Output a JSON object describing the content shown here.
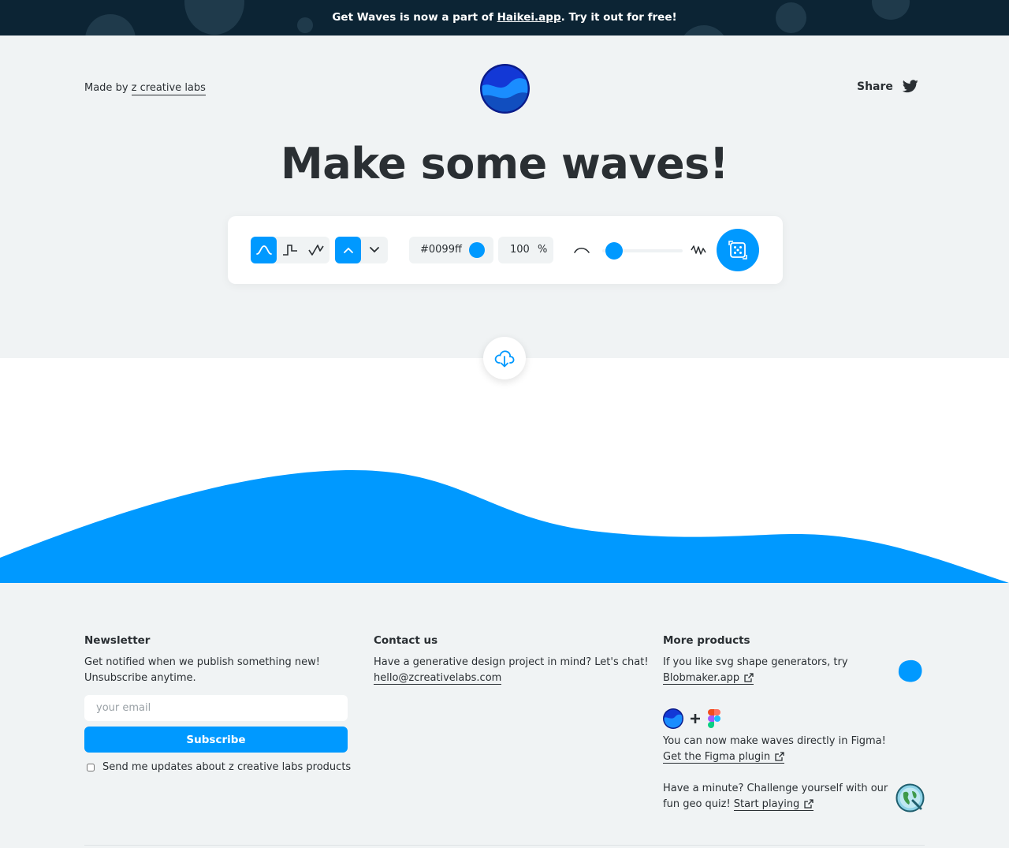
{
  "banner": {
    "text_before": "Get Waves is now a part of ",
    "link": "Haikei.app",
    "text_after": ". Try it out for free!"
  },
  "header": {
    "made_by_prefix": "Made by ",
    "made_by_link": "z creative labs",
    "share_label": "Share"
  },
  "hero": {
    "title": "Make some waves!"
  },
  "toolbar": {
    "wave_types": [
      "smooth-wave-icon",
      "step-wave-icon",
      "peak-wave-icon"
    ],
    "active_wave_type": "smooth-wave-icon",
    "directions": [
      "chevron-up-icon",
      "chevron-down-icon"
    ],
    "active_direction": "chevron-up-icon",
    "color_hex": "#0099ff",
    "opacity_value": "100",
    "opacity_unit": "%",
    "complexity_level": 0.15
  },
  "colors": {
    "accent": "#0099ff",
    "banner_bg": "#0c2434",
    "page_bg": "#f0f3f4",
    "text": "#2a2f33"
  },
  "footer": {
    "newsletter": {
      "title": "Newsletter",
      "line1": "Get notified when we publish something new!",
      "line2": "Unsubscribe anytime.",
      "email_placeholder": "your email",
      "subscribe_label": "Subscribe",
      "consent_label": "Send me updates about z creative labs products"
    },
    "contact": {
      "title": "Contact us",
      "line1": "Have a generative design project in mind? Let's chat!",
      "email": "hello@zcreativelabs.com"
    },
    "products": {
      "title": "More products",
      "blob_text": "If you like svg shape generators, try",
      "blob_link": "Blobmaker.app",
      "figma_text": "You can now make waves directly in Figma!",
      "figma_link": "Get the Figma plugin",
      "quiz_text_1": "Have a minute? Challenge yourself with our",
      "quiz_text_2": "fun geo quiz! ",
      "quiz_link": "Start playing"
    }
  }
}
